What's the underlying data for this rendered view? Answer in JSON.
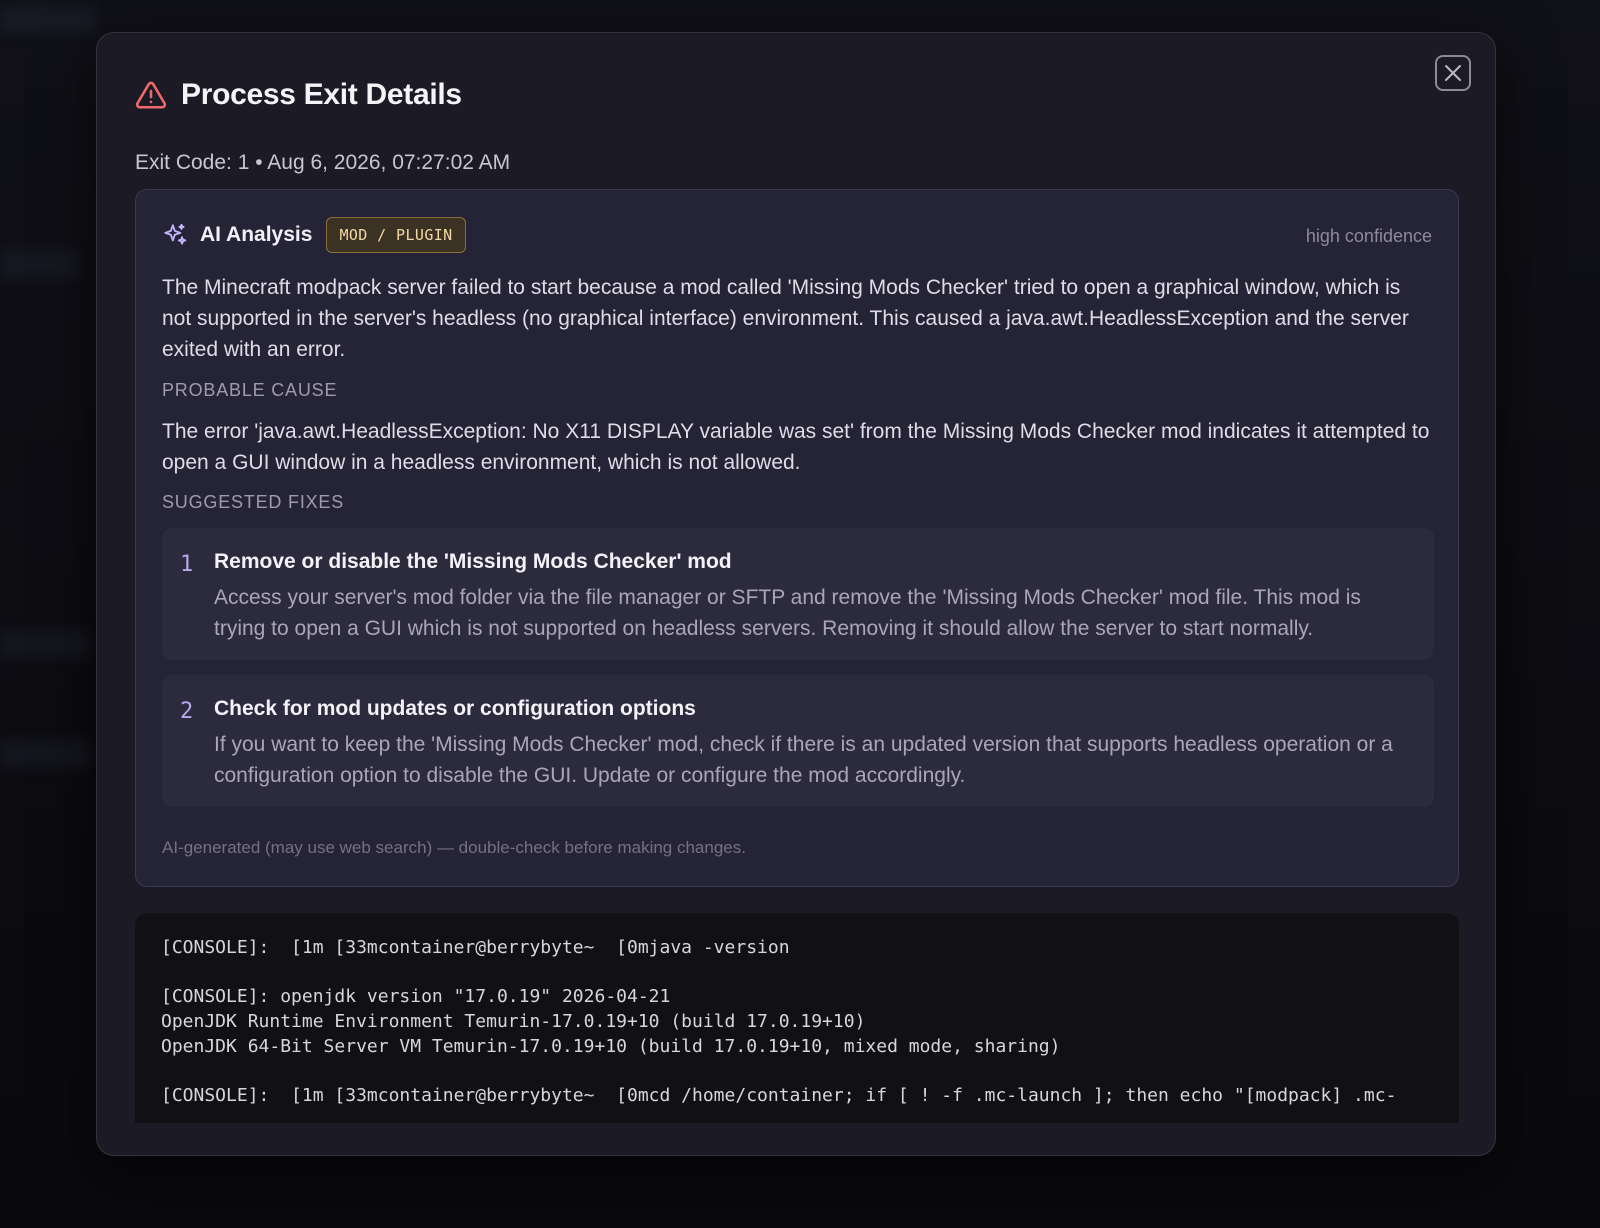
{
  "modal": {
    "title": "Process Exit Details",
    "subtitle": "Exit Code: 1 • Aug 6, 2026, 07:27:02 AM",
    "close_icon": "close-icon",
    "warning_icon": "warning-triangle-icon",
    "accent_color": "#ef6b6b"
  },
  "analysis": {
    "title": "AI Analysis",
    "icon": "sparkle-icon",
    "category": "MOD / PLUGIN",
    "confidence": "high confidence",
    "summary": "The Minecraft modpack server failed to start because a mod called 'Missing Mods Checker' tried to open a graphical window, which is not supported in the server's headless (no graphical interface) environment. This caused a java.awt.HeadlessException and the server exited with an error.",
    "cause_label": "PROBABLE CAUSE",
    "cause": "The error 'java.awt.HeadlessException: No X11 DISPLAY variable was set' from the Missing Mods Checker mod indicates it attempted to open a GUI window in a headless environment, which is not allowed.",
    "fixes_label": "SUGGESTED FIXES",
    "fixes": [
      {
        "number": "1",
        "title": "Remove or disable the 'Missing Mods Checker' mod",
        "description": "Access your server's mod folder via the file manager or SFTP and remove the 'Missing Mods Checker' mod file. This mod is trying to open a GUI which is not supported on headless servers. Removing it should allow the server to start normally."
      },
      {
        "number": "2",
        "title": "Check for mod updates or configuration options",
        "description": "If you want to keep the 'Missing Mods Checker' mod, check if there is an updated version that supports headless operation or a configuration option to disable the GUI. Update or configure the mod accordingly."
      }
    ],
    "disclaimer": "AI-generated (may use web search) — double-check before making changes."
  },
  "console": {
    "lines": [
      "[CONSOLE]:  [1m [33mcontainer@berrybyte~  [0mjava -version",
      "",
      "[CONSOLE]: openjdk version \"17.0.19\" 2026-04-21",
      "OpenJDK Runtime Environment Temurin-17.0.19+10 (build 17.0.19+10)",
      "OpenJDK 64-Bit Server VM Temurin-17.0.19+10 (build 17.0.19+10, mixed mode, sharing)",
      "",
      "[CONSOLE]:  [1m [33mcontainer@berrybyte~  [0mcd /home/container; if [ ! -f .mc-launch ]; then echo \"[modpack] .mc-"
    ]
  }
}
